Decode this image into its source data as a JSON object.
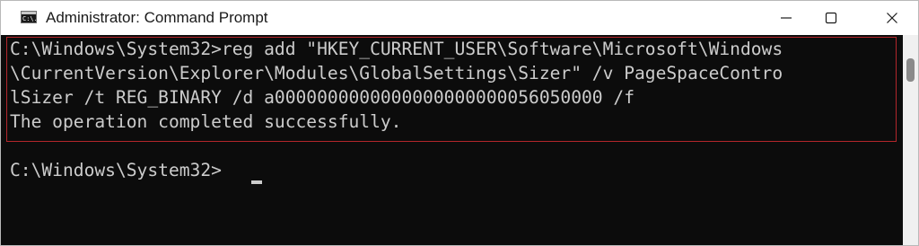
{
  "window": {
    "title": "Administrator: Command Prompt",
    "icon": "cmd-icon",
    "icon_text": "C:\\."
  },
  "controls": {
    "minimize_icon": "minimize-icon",
    "maximize_icon": "maximize-icon",
    "close_icon": "close-icon"
  },
  "console": {
    "lines": [
      "C:\\Windows\\System32>reg add \"HKEY_CURRENT_USER\\Software\\Microsoft\\Windows",
      "\\CurrentVersion\\Explorer\\Modules\\GlobalSettings\\Sizer\" /v PageSpaceContro",
      "lSizer /t REG_BINARY /d a0000000000000000000000056050000 /f",
      "The operation completed successfully.",
      "",
      "C:\\Windows\\System32>"
    ],
    "highlight_color": "#b3262b",
    "text_color": "#cccccc",
    "background": "#0c0c0c"
  }
}
